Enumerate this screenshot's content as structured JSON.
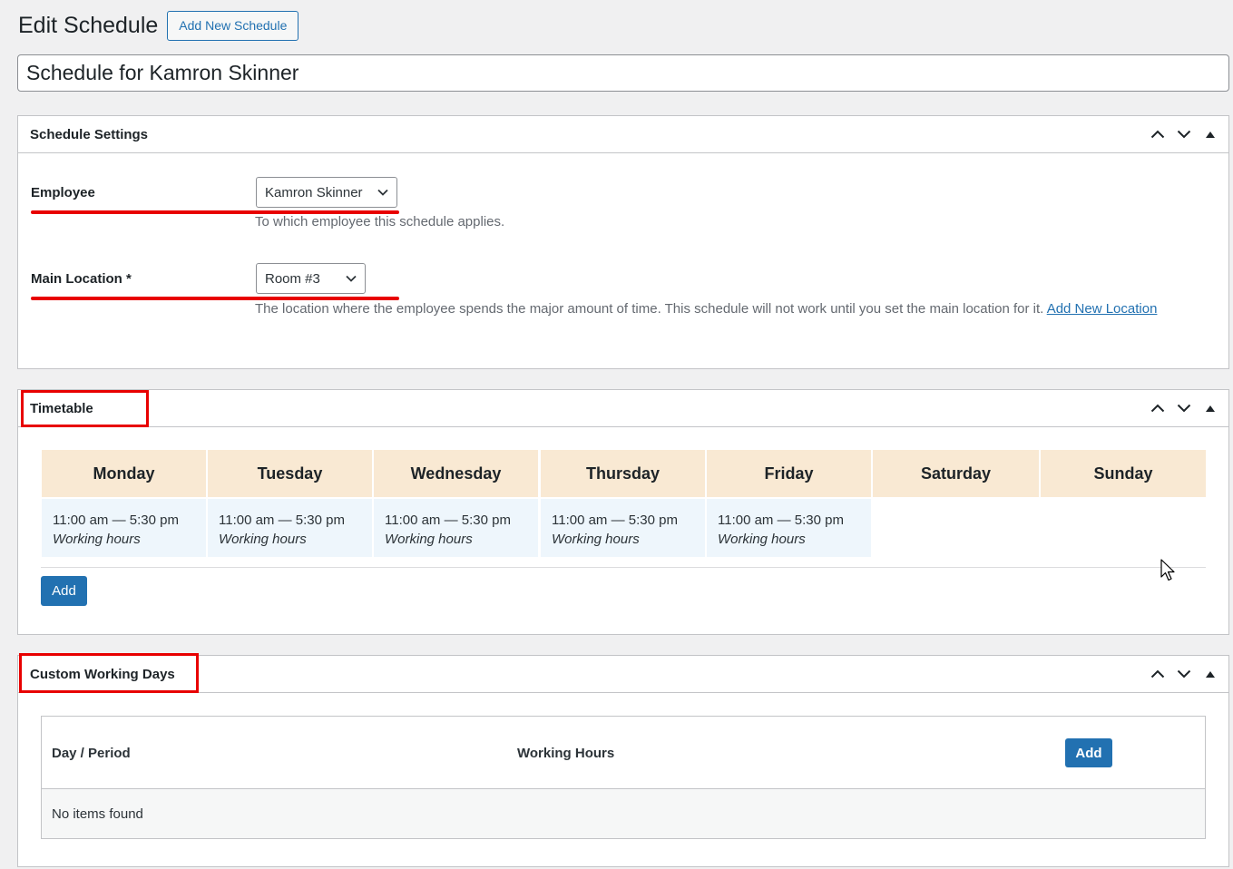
{
  "page": {
    "title": "Edit Schedule",
    "add_new_label": "Add New Schedule",
    "schedule_title": "Schedule for Kamron Skinner"
  },
  "schedule_settings": {
    "title": "Schedule Settings",
    "employee_label": "Employee",
    "employee_value": "Kamron Skinner",
    "employee_desc": "To which employee this schedule applies.",
    "location_label": "Main Location *",
    "location_value": "Room #3",
    "location_desc": "The location where the employee spends the major amount of time. This schedule will not work until you set the main location for it.",
    "location_link": "Add New Location"
  },
  "timetable": {
    "title": "Timetable",
    "days": [
      "Monday",
      "Tuesday",
      "Wednesday",
      "Thursday",
      "Friday",
      "Saturday",
      "Sunday"
    ],
    "slots": [
      {
        "time": "11:00 am — 5:30 pm",
        "type": "Working hours"
      },
      {
        "time": "11:00 am — 5:30 pm",
        "type": "Working hours"
      },
      {
        "time": "11:00 am — 5:30 pm",
        "type": "Working hours"
      },
      {
        "time": "11:00 am — 5:30 pm",
        "type": "Working hours"
      },
      {
        "time": "11:00 am — 5:30 pm",
        "type": "Working hours"
      }
    ],
    "add_label": "Add"
  },
  "custom_days": {
    "title": "Custom Working Days",
    "col_day": "Day / Period",
    "col_hours": "Working Hours",
    "add_label": "Add",
    "empty_text": "No items found"
  },
  "icons": {
    "move_up": "chevron-up-icon",
    "move_down": "chevron-down-icon",
    "toggle": "triangle-up-icon",
    "select_arrow": "chevron-down-icon",
    "cursor": "mouse-pointer-icon"
  },
  "colors": {
    "accent": "#2271b1",
    "highlight": "#e80000",
    "day_header_bg": "#f9e9d3",
    "slot_bg": "#eef6fc"
  }
}
